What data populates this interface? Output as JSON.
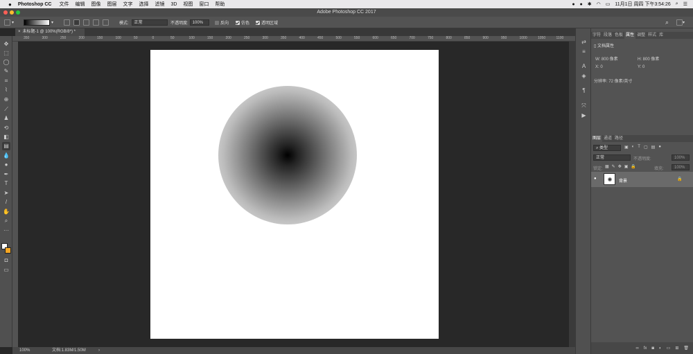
{
  "menubar": {
    "apple": "",
    "app": "Photoshop CC",
    "items": [
      "文件",
      "编辑",
      "图像",
      "图层",
      "文字",
      "选择",
      "滤镜",
      "3D",
      "视图",
      "窗口",
      "帮助"
    ],
    "datetime": "11月1日 周四 下午3:54:26"
  },
  "window": {
    "title": "Adobe Photoshop CC 2017"
  },
  "options": {
    "mode_label": "模式:",
    "mode_value": "正常",
    "opacity_label": "不透明度:",
    "opacity_value": "100%",
    "reverse": "反向",
    "dither": "仿色",
    "transparency": "透明区域"
  },
  "document": {
    "tab": "未标题-1 @ 100%(RGB/8*) *"
  },
  "ruler": {
    "ticks": [
      "350",
      "300",
      "250",
      "200",
      "150",
      "100",
      "50",
      "0",
      "50",
      "100",
      "150",
      "200",
      "250",
      "300",
      "350",
      "400",
      "450",
      "500",
      "550",
      "600",
      "650",
      "700",
      "750",
      "800",
      "850",
      "900",
      "950",
      "1000",
      "1050",
      "1100"
    ]
  },
  "properties": {
    "tabs": [
      "字符",
      "段落",
      "色板",
      "属性",
      "调整",
      "样式",
      "库"
    ],
    "active_tab": "属性",
    "section": "文档属性",
    "w": "W: 800 像素",
    "h": "H: 800 像素",
    "x": "X: 0",
    "y": "Y: 0",
    "resolution": "分辨率: 72 像素/英寸"
  },
  "layers": {
    "tabs": [
      "图层",
      "通道",
      "路径"
    ],
    "active_tab": "图层",
    "filter_label": "类型",
    "blend": "正常",
    "opacity_label": "不透明度:",
    "opacity_value": "100%",
    "lock_label": "锁定:",
    "fill_label": "填充:",
    "fill_value": "100%",
    "layer_name": "背景"
  },
  "status": {
    "zoom": "100%",
    "doc": "文档:1.83M/1.50M"
  },
  "colors": {
    "accent": "#f5a623",
    "canvas": "#ffffff",
    "workspace": "#282828"
  }
}
